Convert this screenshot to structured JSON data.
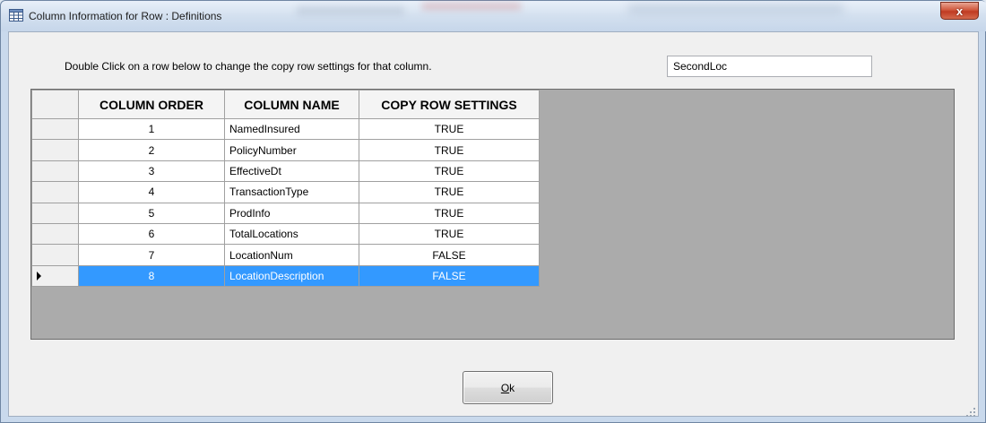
{
  "window": {
    "title": "Column Information for Row : Definitions",
    "close_glyph": "x"
  },
  "instruction": "Double Click on a row below to change the copy row settings for that column.",
  "name_field": {
    "value": "SecondLoc"
  },
  "grid": {
    "headers": [
      "COLUMN ORDER",
      "COLUMN NAME",
      "COPY ROW SETTINGS"
    ],
    "rows": [
      {
        "order": "1",
        "name": "NamedInsured",
        "copy": "TRUE"
      },
      {
        "order": "2",
        "name": "PolicyNumber",
        "copy": "TRUE"
      },
      {
        "order": "3",
        "name": "EffectiveDt",
        "copy": "TRUE"
      },
      {
        "order": "4",
        "name": "TransactionType",
        "copy": "TRUE"
      },
      {
        "order": "5",
        "name": "ProdInfo",
        "copy": "TRUE"
      },
      {
        "order": "6",
        "name": "TotalLocations",
        "copy": "TRUE"
      },
      {
        "order": "7",
        "name": "LocationNum",
        "copy": "FALSE"
      },
      {
        "order": "8",
        "name": "LocationDescription",
        "copy": "FALSE"
      }
    ],
    "selected_row": 8
  },
  "ok_button": {
    "mnemonic": "O",
    "rest": "k"
  },
  "colors": {
    "selection": "#3399ff",
    "grid_background": "#ababab"
  },
  "icons": {
    "app": "table-icon",
    "close": "close-icon",
    "row_pointer": "row-pointer-icon",
    "resize": "resize-grip-icon"
  }
}
